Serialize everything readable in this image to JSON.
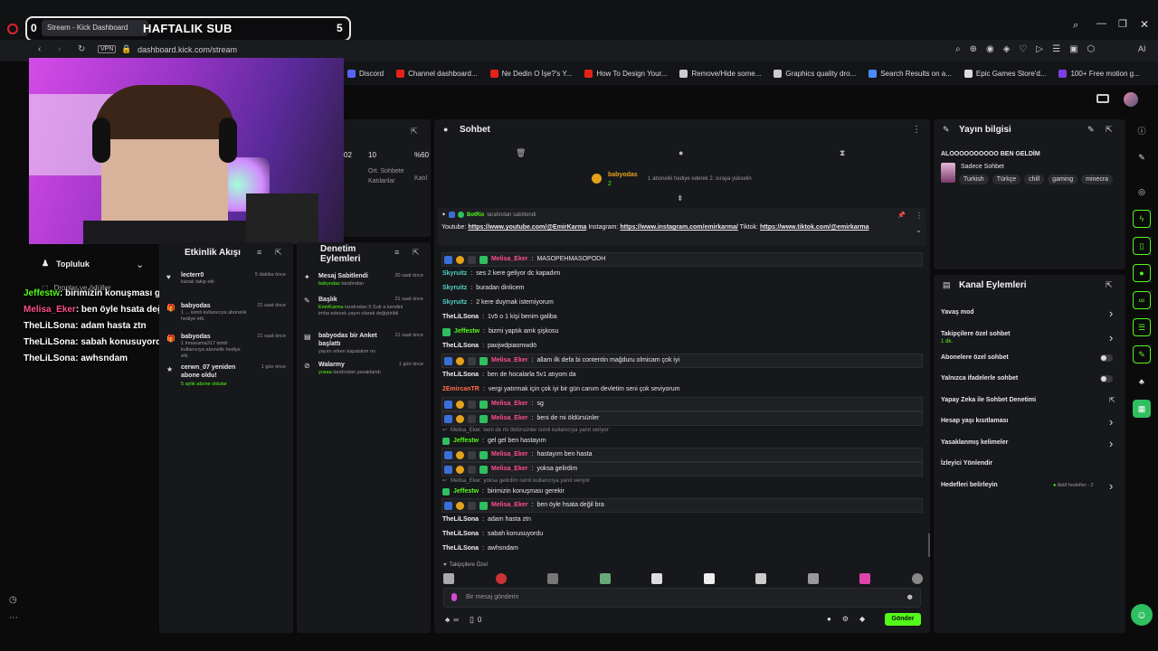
{
  "stream_overlay": {
    "left_count": "0",
    "title": "HAFTALIK SUB",
    "right_count": "5",
    "tab_title": "Stream - Kick Dashboard"
  },
  "browser": {
    "vpn": "VPN",
    "url": "dashboard.kick.com/stream",
    "ai_label": "AI",
    "bookmarks": [
      {
        "label": "Discord",
        "color": "#5865f2"
      },
      {
        "label": "Channel dashboard...",
        "color": "#e62117"
      },
      {
        "label": "Ne Dedin O İşe?'s Y...",
        "color": "#e62117"
      },
      {
        "label": "How To Design Your...",
        "color": "#e62117"
      },
      {
        "label": "Remove/Hide some...",
        "color": "#cccccc"
      },
      {
        "label": "Graphics quality dro...",
        "color": "#cccccc"
      },
      {
        "label": "Search Results on a...",
        "color": "#4a8cff"
      },
      {
        "label": "Epic Games Store'd...",
        "color": "#dddddd"
      },
      {
        "label": "100+ Free motion g...",
        "color": "#7b3fe4"
      }
    ]
  },
  "left_nav": {
    "community": "Topluluk",
    "drops": "Droplar ve ödüller"
  },
  "overlay_chat": [
    {
      "user": "Jeffestw",
      "text": ": birimizin konuşması gerekir",
      "color": "#53fc18"
    },
    {
      "user": "Melisa_Eker",
      "text": ": ben öyle hsata değil bra",
      "color": "#ff4f8a"
    },
    {
      "user": "TheLiLSona",
      "text": ": adam hasta ztn",
      "color": "#ffffff"
    },
    {
      "user": "TheLiLSona",
      "text": ": sabah konusuyordu",
      "color": "#ffffff"
    },
    {
      "user": "TheLiLSona",
      "text": ": awhsndam",
      "color": "#ffffff"
    }
  ],
  "stats_panel": {
    "v1": "02",
    "v2": "10",
    "v3": "%60",
    "l2": "Ort. Sohbete Katılanlar",
    "l3": "Katıl"
  },
  "activity": {
    "title": "Etkinlik Akışı",
    "items": [
      {
        "name": "lecterr0",
        "desc": "kanalı takip etti",
        "time": "5 dakika önce"
      },
      {
        "name": "babyodas",
        "desc": "1 ... isimli kullanıcıya abonelik hediye etti.",
        "time": "21 saat önce"
      },
      {
        "name": "babyodas",
        "desc": "1 lrmaxama317 isimli kullanıcıya abonelik hediye etti.",
        "time": "21 saat önce"
      },
      {
        "name": "cerwn_07 yeniden abone oldu!",
        "desc": "5 aylık abone oldular",
        "time": "1 gün önce"
      }
    ]
  },
  "mod_actions": {
    "title": "Denetim Eylemleri",
    "items": [
      {
        "title": "Mesaj Sabitlendi",
        "by": "babyodas",
        "desc": "tarafından",
        "time": "20 saat önce"
      },
      {
        "title": "Başlık",
        "by": "EmirKarma",
        "desc": "tarafından 5 Sub a kendini imha edecek yayın olarak değiştirildi",
        "time": "21 saat önce"
      },
      {
        "title": "babyodas bir Anket başlattı",
        "by": "",
        "desc": "yayını erken kapatalım mı",
        "time": "21 saat önce"
      },
      {
        "title": "Walarmy",
        "by": "yusaa",
        "desc": "tarafından yasaklandı",
        "time": "1 gün önce"
      }
    ]
  },
  "chat": {
    "title": "Sohbet",
    "gift_user": "babyodas",
    "gift_count": "2",
    "gift_text": "1 abonelik hediye ederek 2. sıraya yükselin",
    "pinned_by": "BotRix",
    "pinned_suffix": "tarafından sabitlendi",
    "pinned_text_1": "Youtube:",
    "pinned_link_1": "https://www.youtube.com/@EmirKarma",
    "pinned_text_2": "Instagram:",
    "pinned_link_2": "https://www.instagram.com/emirkarma/",
    "pinned_text_3": "Tiktok:",
    "pinned_link_3": "https://www.tiktok.com/@emirkarma",
    "messages": [
      {
        "user": "Melisa_Eker",
        "text": "MASOPEHMASOPODH",
        "style": "pink",
        "boxed": true
      },
      {
        "user": "Skyruitz",
        "text": "ses 2 kere geliyor dc kapadım",
        "style": "teal",
        "boxed": false
      },
      {
        "user": "Skyruitz",
        "text": "buradan dinlicem",
        "style": "teal",
        "boxed": false
      },
      {
        "user": "Skyruitz",
        "text": "2 kere duymak istemiyorum",
        "style": "teal",
        "boxed": false
      },
      {
        "user": "TheLiLSona",
        "text": "1v5 o 1 kişi benim galiba",
        "style": "white",
        "boxed": false
      },
      {
        "user": "Jeffestw",
        "text": "bizmi yaptık amk şişkosu",
        "style": "green",
        "boxed": false
      },
      {
        "user": "TheLiLSona",
        "text": "paojwdpiaomwdö",
        "style": "white",
        "boxed": false
      },
      {
        "user": "Melisa_Eker",
        "text": "allam ilk defa bi contentin mağduru olmicam çok iyi",
        "style": "pink",
        "boxed": true
      },
      {
        "user": "TheLiLSona",
        "text": "ben de hocalarla 5v1 atıyom da",
        "style": "white",
        "boxed": false
      },
      {
        "user": "2EmircanTR",
        "text": "vergi yatırmak için çok iyi bir gün canım devletim seni çok seviyorum",
        "style": "orange",
        "boxed": false
      },
      {
        "user": "Melisa_Eker",
        "text": "sg",
        "style": "pink",
        "boxed": true
      },
      {
        "user": "Melisa_Eker",
        "text": "beni de mi öldürsünler",
        "style": "pink",
        "boxed": true
      }
    ],
    "reply_1": "Melisa_Eker: beni de mi öldürsünler isimli kullanıcıya yanıt veriyor",
    "reply_1_user": "Jeffestw",
    "reply_1_text": "gel gel ben hastayım",
    "messages2": [
      {
        "user": "Melisa_Eker",
        "text": "hastayım ben hasta",
        "style": "pink",
        "boxed": true
      },
      {
        "user": "Melisa_Eker",
        "text": "yoksa gelirdim",
        "style": "pink",
        "boxed": true
      }
    ],
    "reply_2": "Melisa_Eker: yoksa gelirdim isimli kullanıcıya yanıt veriyor",
    "reply_2_user": "Jeffestw",
    "reply_2_text": "birimizin konuşması gerekir",
    "messages3": [
      {
        "user": "Melisa_Eker",
        "text": "ben öyle hsata değil bra",
        "style": "pink",
        "boxed": true
      },
      {
        "user": "TheLiLSona",
        "text": "adam hasta ztn",
        "style": "white",
        "boxed": false
      },
      {
        "user": "TheLiLSona",
        "text": "sabah konusuyordu",
        "style": "white",
        "boxed": false
      },
      {
        "user": "TheLiLSona",
        "text": "awhsndam",
        "style": "white",
        "boxed": false
      }
    ],
    "followers_label": "Takipçilere Özel",
    "input_placeholder": "Bir mesaj gönderin",
    "points": "0",
    "send": "Gönder"
  },
  "stream_info": {
    "title": "Yayın bilgisi",
    "stream_title": "ALOOOOOOOOOO BEN GELDİM",
    "category": "Sadece Sohbet",
    "tags": [
      "Turkish",
      "Türkçe",
      "chill",
      "gaming",
      "minecra"
    ]
  },
  "channel_actions": {
    "title": "Kanal Eylemleri",
    "items": [
      {
        "label": "Yavaş mod",
        "sub": "",
        "control": "chevron"
      },
      {
        "label": "Takipçilere özel sohbet",
        "sub": "1 dk.",
        "control": "chevron"
      },
      {
        "label": "Abonelere özel sohbet",
        "sub": "",
        "control": "toggle"
      },
      {
        "label": "Yalnızca ifadelerle sohbet",
        "sub": "",
        "control": "toggle"
      },
      {
        "label": "Yapay Zeka ile Sohbet Denetimi",
        "sub": "",
        "control": "external"
      },
      {
        "label": "Hesap yaşı kısıtlaması",
        "sub": "",
        "control": "chevron"
      },
      {
        "label": "Yasaklanmış kelimeler",
        "sub": "",
        "control": "chevron"
      },
      {
        "label": "İzleyici Yönlendir",
        "sub": "",
        "control": "none"
      },
      {
        "label": "Hedefleri belirleyin",
        "sub": "",
        "control": "chevron"
      }
    ],
    "goals_status": "Aktif hedefler - 2"
  }
}
